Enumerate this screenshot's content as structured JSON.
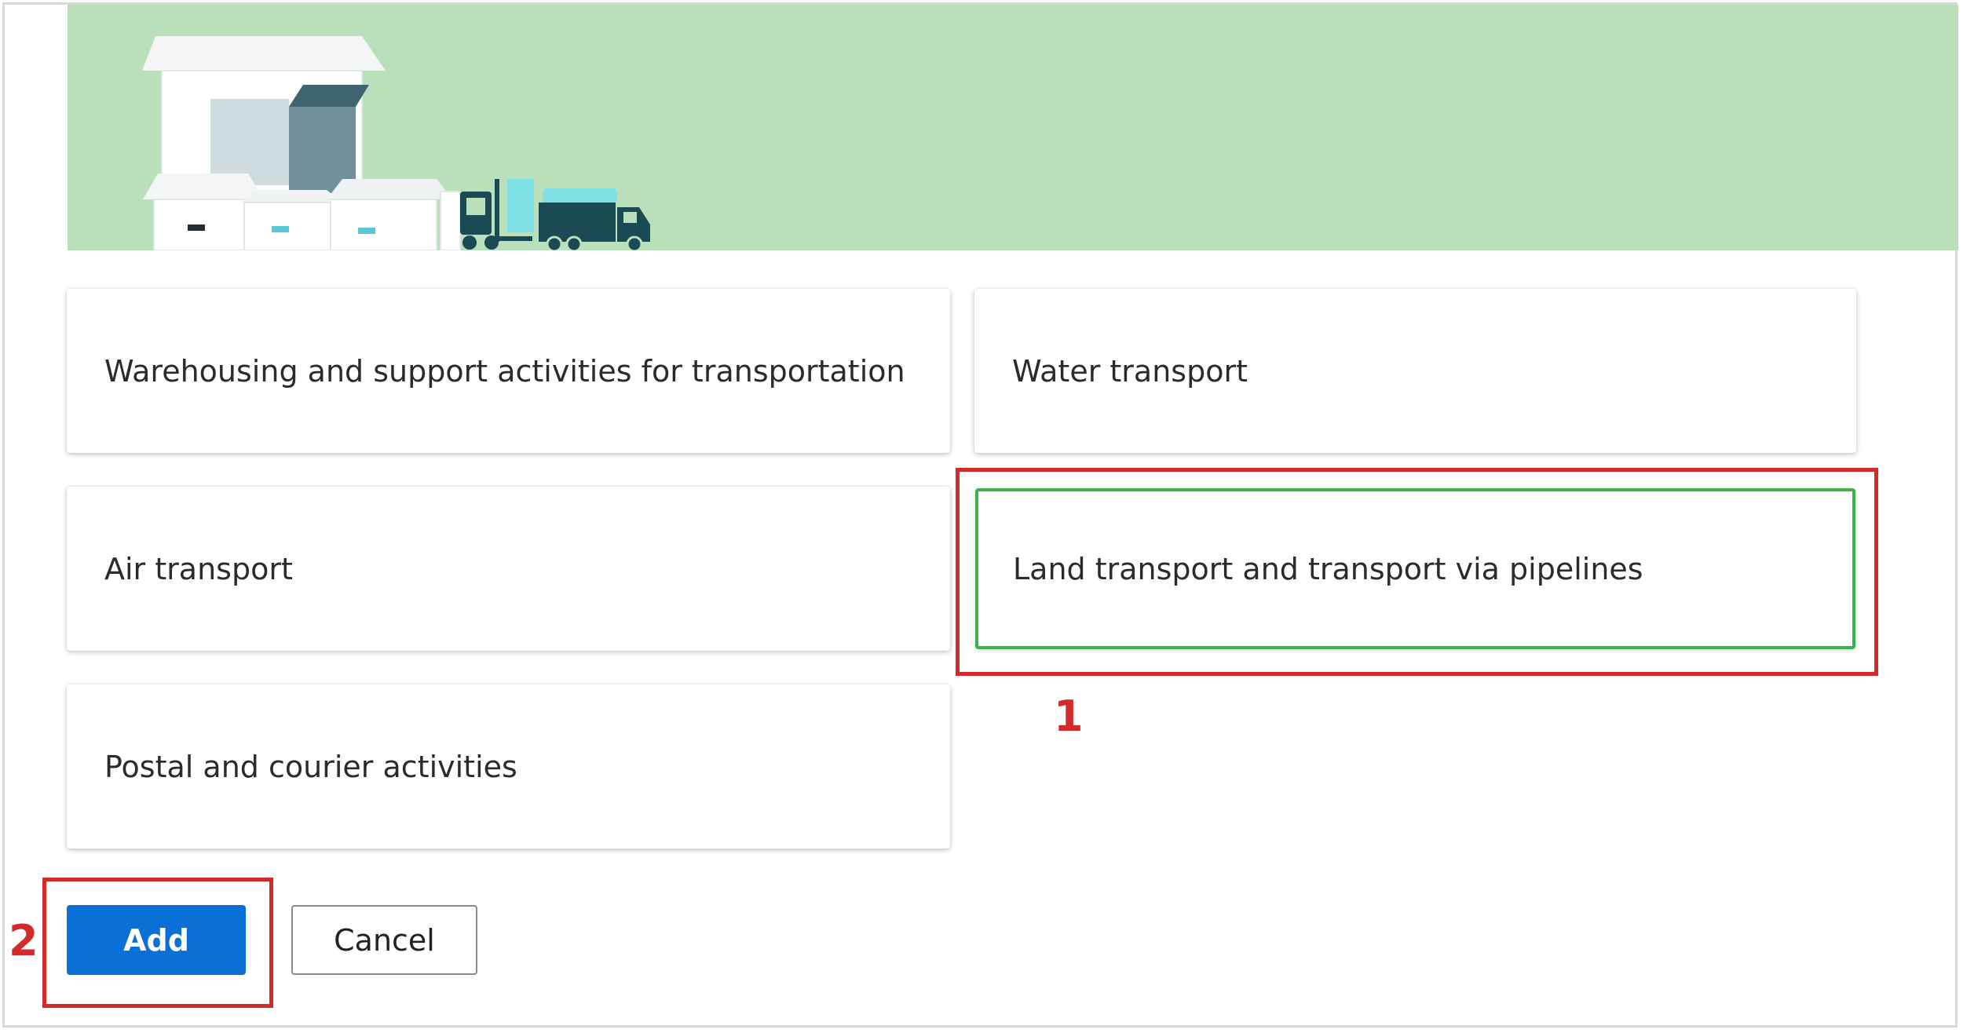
{
  "options": [
    {
      "label": "Warehousing and support activities for transportation",
      "selected": false
    },
    {
      "label": "Water transport",
      "selected": false
    },
    {
      "label": "Air transport",
      "selected": false
    },
    {
      "label": "Land transport and transport via pipelines",
      "selected": true
    },
    {
      "label": "Postal and courier activities",
      "selected": false
    }
  ],
  "actions": {
    "add_label": "Add",
    "cancel_label": "Cancel"
  },
  "annotations": {
    "step1": "1",
    "step2": "2"
  },
  "colors": {
    "banner_bg": "#badfbb",
    "selected_border": "#3cb34a",
    "primary_button": "#0a6fd6",
    "annotation_red": "#d42a2a"
  },
  "banner": {
    "illustration": "warehouse-boxes-forklift-truck-icon"
  }
}
